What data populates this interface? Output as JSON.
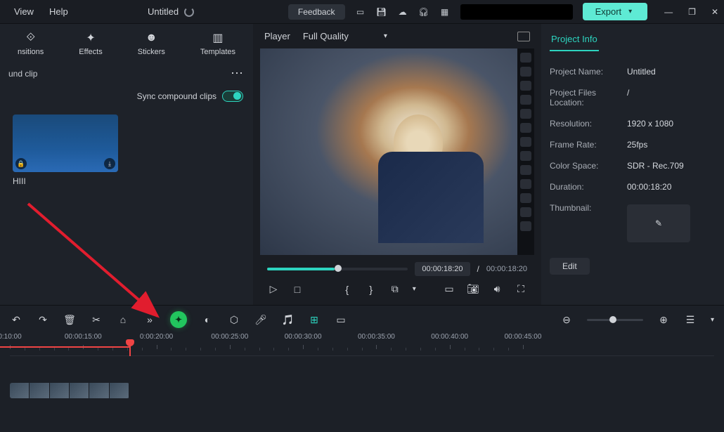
{
  "menu": {
    "view": "View",
    "help": "Help"
  },
  "title": "Untitled",
  "topbar": {
    "feedback": "Feedback",
    "export": "Export"
  },
  "tabs": {
    "transitions": "nsitions",
    "effects": "Effects",
    "stickers": "Stickers",
    "templates": "Templates"
  },
  "clips": {
    "header": "und clip",
    "sync": "Sync compound clips",
    "item1": "HIII"
  },
  "player": {
    "label": "Player",
    "quality": "Full Quality",
    "current": "00:00:18:20",
    "total": "00:00:18:20"
  },
  "info": {
    "tab": "Project Info",
    "name_label": "Project Name:",
    "name_value": "Untitled",
    "loc_label": "Project Files Location:",
    "loc_value": "/",
    "res_label": "Resolution:",
    "res_value": "1920 x 1080",
    "fps_label": "Frame Rate:",
    "fps_value": "25fps",
    "color_label": "Color Space:",
    "color_value": "SDR - Rec.709",
    "dur_label": "Duration:",
    "dur_value": "00:00:18:20",
    "thumb_label": "Thumbnail:",
    "edit": "Edit"
  },
  "ruler": {
    "marks": [
      "0:10:00",
      "00:00:15:00",
      "0:00:20:00",
      "00:00:25:00",
      "00:00:30:00",
      "00:00:35:00",
      "00:00:40:00",
      "00:00:45:00"
    ]
  }
}
